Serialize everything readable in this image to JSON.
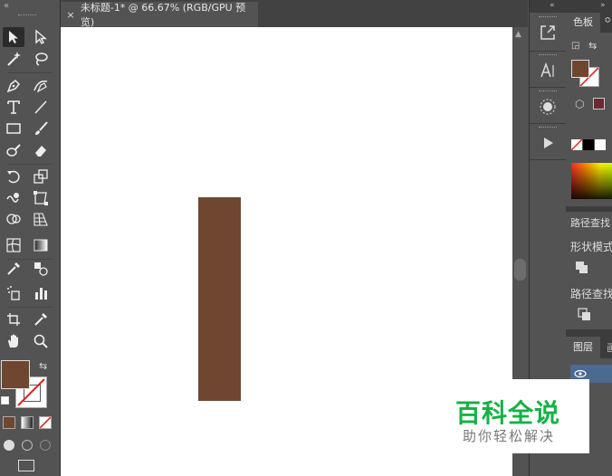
{
  "document_tab": {
    "close_glyph": "×",
    "title": "未标题-1* @ 66.67% (RGB/GPU 预览)"
  },
  "toolbox": {
    "tools": [
      "selection-tool",
      "direct-selection-tool",
      "magic-wand-tool",
      "lasso-tool",
      "pen-tool",
      "curvature-tool",
      "type-tool",
      "line-segment-tool",
      "rectangle-tool",
      "paintbrush-tool",
      "shaper-tool",
      "eraser-tool",
      "rotate-tool",
      "scale-tool",
      "warp-tool",
      "free-transform-tool",
      "shape-builder-tool",
      "perspective-grid-tool",
      "mesh-tool",
      "gradient-tool",
      "eyedropper-tool",
      "blend-tool",
      "symbol-sprayer-tool",
      "column-graph-tool",
      "artboard-tool",
      "slice-tool",
      "hand-tool",
      "zoom-tool"
    ],
    "fill_color": "#6f4731",
    "stroke": "none"
  },
  "canvas": {
    "background": "#ffffff",
    "shape_color": "#6f4731"
  },
  "right_panel": {
    "color_tab": "色板",
    "pathfinder_tab": "路径查找",
    "shape_modes_label": "形状模式",
    "pathfinders_label": "路径查找",
    "layers_tab": "图层",
    "layers_tab_cut": "画"
  },
  "watermark": {
    "main": "百科全说",
    "sub": "助你轻松解决"
  }
}
